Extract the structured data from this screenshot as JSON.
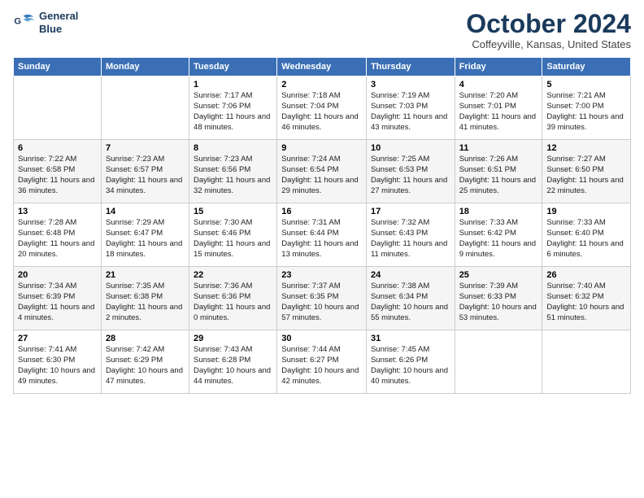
{
  "logo": {
    "line1": "General",
    "line2": "Blue"
  },
  "title": "October 2024",
  "subtitle": "Coffeyville, Kansas, United States",
  "days_header": [
    "Sunday",
    "Monday",
    "Tuesday",
    "Wednesday",
    "Thursday",
    "Friday",
    "Saturday"
  ],
  "weeks": [
    [
      {
        "day": "",
        "info": ""
      },
      {
        "day": "",
        "info": ""
      },
      {
        "day": "1",
        "info": "Sunrise: 7:17 AM\nSunset: 7:06 PM\nDaylight: 11 hours and 48 minutes."
      },
      {
        "day": "2",
        "info": "Sunrise: 7:18 AM\nSunset: 7:04 PM\nDaylight: 11 hours and 46 minutes."
      },
      {
        "day": "3",
        "info": "Sunrise: 7:19 AM\nSunset: 7:03 PM\nDaylight: 11 hours and 43 minutes."
      },
      {
        "day": "4",
        "info": "Sunrise: 7:20 AM\nSunset: 7:01 PM\nDaylight: 11 hours and 41 minutes."
      },
      {
        "day": "5",
        "info": "Sunrise: 7:21 AM\nSunset: 7:00 PM\nDaylight: 11 hours and 39 minutes."
      }
    ],
    [
      {
        "day": "6",
        "info": "Sunrise: 7:22 AM\nSunset: 6:58 PM\nDaylight: 11 hours and 36 minutes."
      },
      {
        "day": "7",
        "info": "Sunrise: 7:23 AM\nSunset: 6:57 PM\nDaylight: 11 hours and 34 minutes."
      },
      {
        "day": "8",
        "info": "Sunrise: 7:23 AM\nSunset: 6:56 PM\nDaylight: 11 hours and 32 minutes."
      },
      {
        "day": "9",
        "info": "Sunrise: 7:24 AM\nSunset: 6:54 PM\nDaylight: 11 hours and 29 minutes."
      },
      {
        "day": "10",
        "info": "Sunrise: 7:25 AM\nSunset: 6:53 PM\nDaylight: 11 hours and 27 minutes."
      },
      {
        "day": "11",
        "info": "Sunrise: 7:26 AM\nSunset: 6:51 PM\nDaylight: 11 hours and 25 minutes."
      },
      {
        "day": "12",
        "info": "Sunrise: 7:27 AM\nSunset: 6:50 PM\nDaylight: 11 hours and 22 minutes."
      }
    ],
    [
      {
        "day": "13",
        "info": "Sunrise: 7:28 AM\nSunset: 6:48 PM\nDaylight: 11 hours and 20 minutes."
      },
      {
        "day": "14",
        "info": "Sunrise: 7:29 AM\nSunset: 6:47 PM\nDaylight: 11 hours and 18 minutes."
      },
      {
        "day": "15",
        "info": "Sunrise: 7:30 AM\nSunset: 6:46 PM\nDaylight: 11 hours and 15 minutes."
      },
      {
        "day": "16",
        "info": "Sunrise: 7:31 AM\nSunset: 6:44 PM\nDaylight: 11 hours and 13 minutes."
      },
      {
        "day": "17",
        "info": "Sunrise: 7:32 AM\nSunset: 6:43 PM\nDaylight: 11 hours and 11 minutes."
      },
      {
        "day": "18",
        "info": "Sunrise: 7:33 AM\nSunset: 6:42 PM\nDaylight: 11 hours and 9 minutes."
      },
      {
        "day": "19",
        "info": "Sunrise: 7:33 AM\nSunset: 6:40 PM\nDaylight: 11 hours and 6 minutes."
      }
    ],
    [
      {
        "day": "20",
        "info": "Sunrise: 7:34 AM\nSunset: 6:39 PM\nDaylight: 11 hours and 4 minutes."
      },
      {
        "day": "21",
        "info": "Sunrise: 7:35 AM\nSunset: 6:38 PM\nDaylight: 11 hours and 2 minutes."
      },
      {
        "day": "22",
        "info": "Sunrise: 7:36 AM\nSunset: 6:36 PM\nDaylight: 11 hours and 0 minutes."
      },
      {
        "day": "23",
        "info": "Sunrise: 7:37 AM\nSunset: 6:35 PM\nDaylight: 10 hours and 57 minutes."
      },
      {
        "day": "24",
        "info": "Sunrise: 7:38 AM\nSunset: 6:34 PM\nDaylight: 10 hours and 55 minutes."
      },
      {
        "day": "25",
        "info": "Sunrise: 7:39 AM\nSunset: 6:33 PM\nDaylight: 10 hours and 53 minutes."
      },
      {
        "day": "26",
        "info": "Sunrise: 7:40 AM\nSunset: 6:32 PM\nDaylight: 10 hours and 51 minutes."
      }
    ],
    [
      {
        "day": "27",
        "info": "Sunrise: 7:41 AM\nSunset: 6:30 PM\nDaylight: 10 hours and 49 minutes."
      },
      {
        "day": "28",
        "info": "Sunrise: 7:42 AM\nSunset: 6:29 PM\nDaylight: 10 hours and 47 minutes."
      },
      {
        "day": "29",
        "info": "Sunrise: 7:43 AM\nSunset: 6:28 PM\nDaylight: 10 hours and 44 minutes."
      },
      {
        "day": "30",
        "info": "Sunrise: 7:44 AM\nSunset: 6:27 PM\nDaylight: 10 hours and 42 minutes."
      },
      {
        "day": "31",
        "info": "Sunrise: 7:45 AM\nSunset: 6:26 PM\nDaylight: 10 hours and 40 minutes."
      },
      {
        "day": "",
        "info": ""
      },
      {
        "day": "",
        "info": ""
      }
    ]
  ]
}
